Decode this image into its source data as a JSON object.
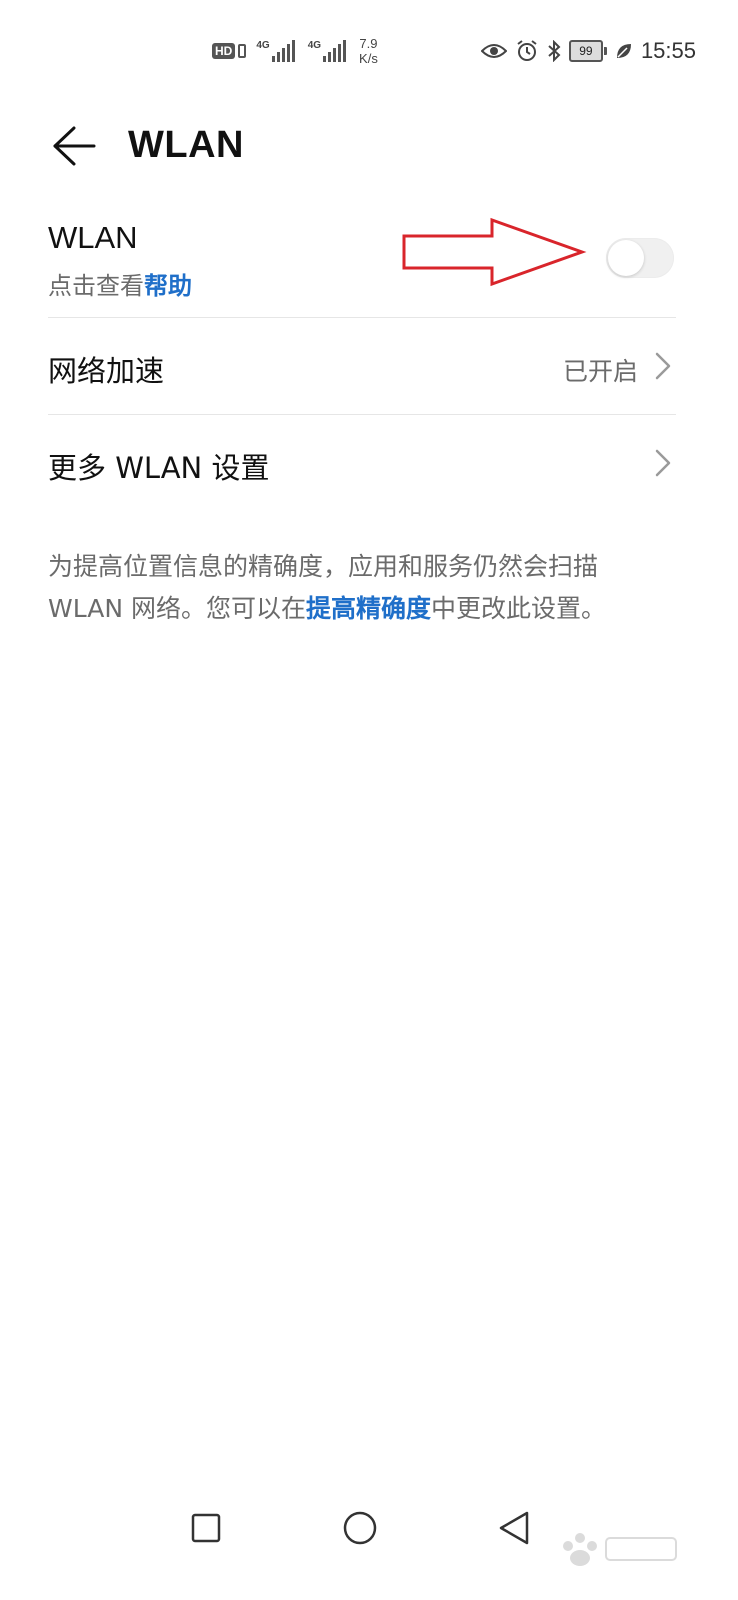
{
  "status_bar": {
    "hd_label": "HD",
    "sim1_label": "4G",
    "sim2_label": "4G",
    "speed_value": "7.9",
    "speed_unit": "K/s",
    "battery_level": "99",
    "time": "15:55",
    "icons": [
      "eye-icon",
      "alarm-icon",
      "bluetooth-icon",
      "battery-icon",
      "leaf-icon"
    ]
  },
  "app_bar": {
    "title": "WLAN",
    "back_icon": "arrow-left-icon"
  },
  "wlan_row": {
    "title": "WLAN",
    "subtitle_prefix": "点击查看",
    "help_link": "帮助",
    "toggle_state": "off"
  },
  "network_accel_row": {
    "title": "网络加速",
    "value": "已开启"
  },
  "more_settings_row": {
    "title": "更多 WLAN 设置"
  },
  "info": {
    "text_before": "为提高位置信息的精确度，应用和服务仍然会扫描 WLAN 网络。您可以在",
    "link": "提高精确度",
    "text_after": "中更改此设置。"
  },
  "colors": {
    "link": "#1f6fc9",
    "annotation": "#d9252b",
    "secondary_text": "#6b6b6b",
    "divider": "#e6e6e6"
  },
  "nav_bar": {
    "buttons": [
      "recents-square-icon",
      "home-circle-icon",
      "back-triangle-icon"
    ]
  }
}
